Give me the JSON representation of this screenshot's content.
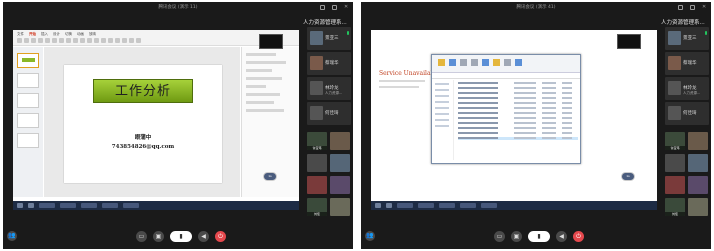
{
  "windows": [
    {
      "title": "腾讯会议 (演示 11)",
      "panel_title": "人力资源管理系...",
      "participants": [
        {
          "name": "景亚三",
          "sub": ""
        },
        {
          "name": "蔡瑞华",
          "sub": ""
        },
        {
          "name": "林玲龙",
          "sub": "人力资源..."
        },
        {
          "name": "何佳琦",
          "sub": ""
        }
      ],
      "thumbs": [
        "许宝玮",
        "",
        "",
        "",
        "",
        "",
        "刘佳",
        ""
      ],
      "share": {
        "type": "presentation",
        "tabs": [
          "文件",
          "开始",
          "插入",
          "设计",
          "切换",
          "动画",
          "放映"
        ],
        "slide_title": "工作分析",
        "slide_name": "眼蒲中",
        "slide_mail": "743854826@qq.com",
        "bubble": "1s"
      }
    },
    {
      "title": "腾讯会议 (演示 41)",
      "panel_title": "人力资源管理系...",
      "participants": [
        {
          "name": "景亚三",
          "sub": ""
        },
        {
          "name": "蔡瑞华",
          "sub": ""
        },
        {
          "name": "林玲龙",
          "sub": "人力资源..."
        },
        {
          "name": "何佳琦",
          "sub": ""
        }
      ],
      "thumbs": [
        "许宝玮",
        "",
        "",
        "",
        "",
        "",
        "刘佳",
        ""
      ],
      "share": {
        "type": "explorer",
        "web_heading": "Service Unavailable",
        "bubble": "1s"
      }
    }
  ],
  "colors": {
    "end_call": "#e5484d",
    "mic_on": "#22c55e",
    "slide_title_bg": "#8ab828"
  },
  "icons": {
    "left": "participants-icon",
    "controls": [
      "share-screen-icon",
      "record-icon",
      "microphone-icon",
      "speaker-icon",
      "end-call-icon"
    ]
  }
}
